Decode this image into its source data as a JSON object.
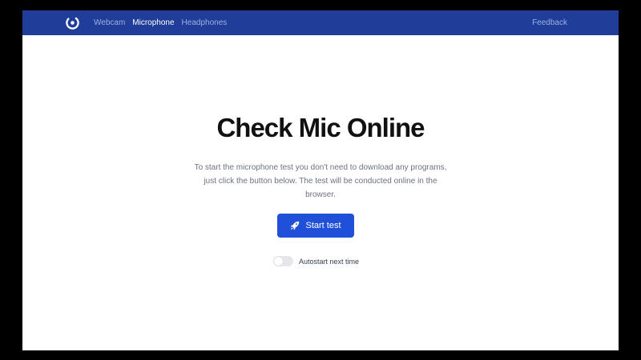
{
  "navbar": {
    "logo_icon": "ring-logo-icon",
    "links": [
      {
        "label": "Webcam",
        "active": false
      },
      {
        "label": "Microphone",
        "active": true
      },
      {
        "label": "Headphones",
        "active": false
      }
    ],
    "feedback_label": "Feedback"
  },
  "hero": {
    "title": "Check Mic Online",
    "description": "To start the microphone test you don't need to download any programs, just click the button below. The test will be conducted online in the browser."
  },
  "start_button": {
    "label": "Start test",
    "icon": "rocket-icon"
  },
  "autostart": {
    "label": "Autostart next time",
    "enabled": false
  },
  "colors": {
    "navbar_bg": "#1f3d99",
    "accent": "#2150d8",
    "nav_link": "#9fb1e3",
    "nav_link_active": "#ffffff"
  }
}
